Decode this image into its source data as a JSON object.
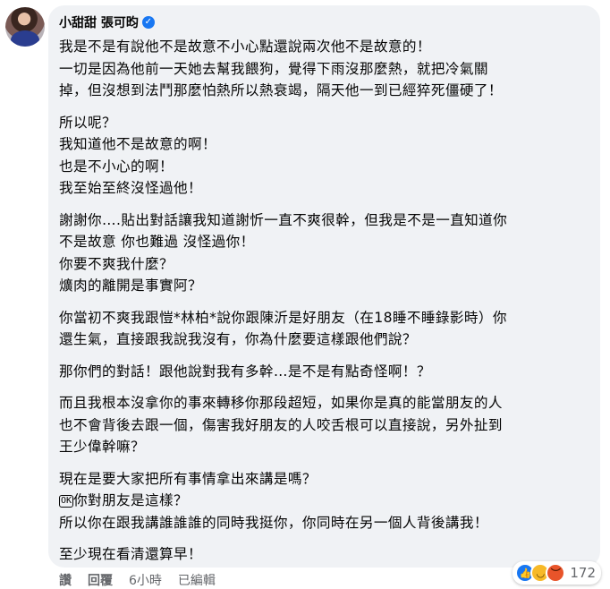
{
  "comment": {
    "author": "小甜甜 張可昀",
    "verified_icon": "check-badge-icon",
    "paragraphs": [
      [
        "我是不是有說他不是故意不小心點還說兩次他不是故意的！",
        "一切是因為他前一天她去幫我餵狗，覺得下雨沒那麼熱，就把冷氣關",
        "掉，但沒想到法鬥那麼怕熱所以熱衰竭，隔天他一到已經猝死僵硬了！"
      ],
      [
        "所以呢？",
        "我知道他不是故意的啊！",
        "也是不小心的啊！",
        "我至始至終沒怪過他！"
      ],
      [
        "謝謝你….貼出對話讓我知道謝忻一直不爽很幹，但我是不是一直知道你",
        "不是故意 你也難過 沒怪過你！",
        "你要不爽我什麼？",
        "爌肉的離開是事實阿？"
      ],
      [
        "你當初不爽我跟愷*林柏*說你跟陳沂是好朋友（在18睡不睡錄影時）你",
        "還生氣，直接跟我說我沒有，你為什麼要這樣跟他們說？"
      ],
      [
        "那你們的對話！跟他說對我有多幹…是不是有點奇怪啊！？"
      ],
      [
        "而且我根本沒拿你的事來轉移你那段超短，如果你是真的能當朋友的人",
        "也不會背後去跟一個，傷害我好朋友的人咬舌根可以直接說，另外扯到",
        "王少偉幹嘛？"
      ],
      [
        "現在是要大家把所有事情拿出來講是嗎？",
        "你對朋友是這樣？",
        "所以你在跟我講誰誰誰的同時我挺你，你同時在另一個人背後講我！"
      ],
      [
        "至少現在看清還算早！"
      ]
    ],
    "emoji_badge": "OK",
    "reactions": {
      "icons": [
        "like-icon",
        "haha-icon",
        "angry-icon"
      ],
      "count": "172"
    },
    "actions": {
      "like": "讚",
      "reply": "回覆",
      "time": "6小時",
      "edited": "已編輯"
    }
  }
}
